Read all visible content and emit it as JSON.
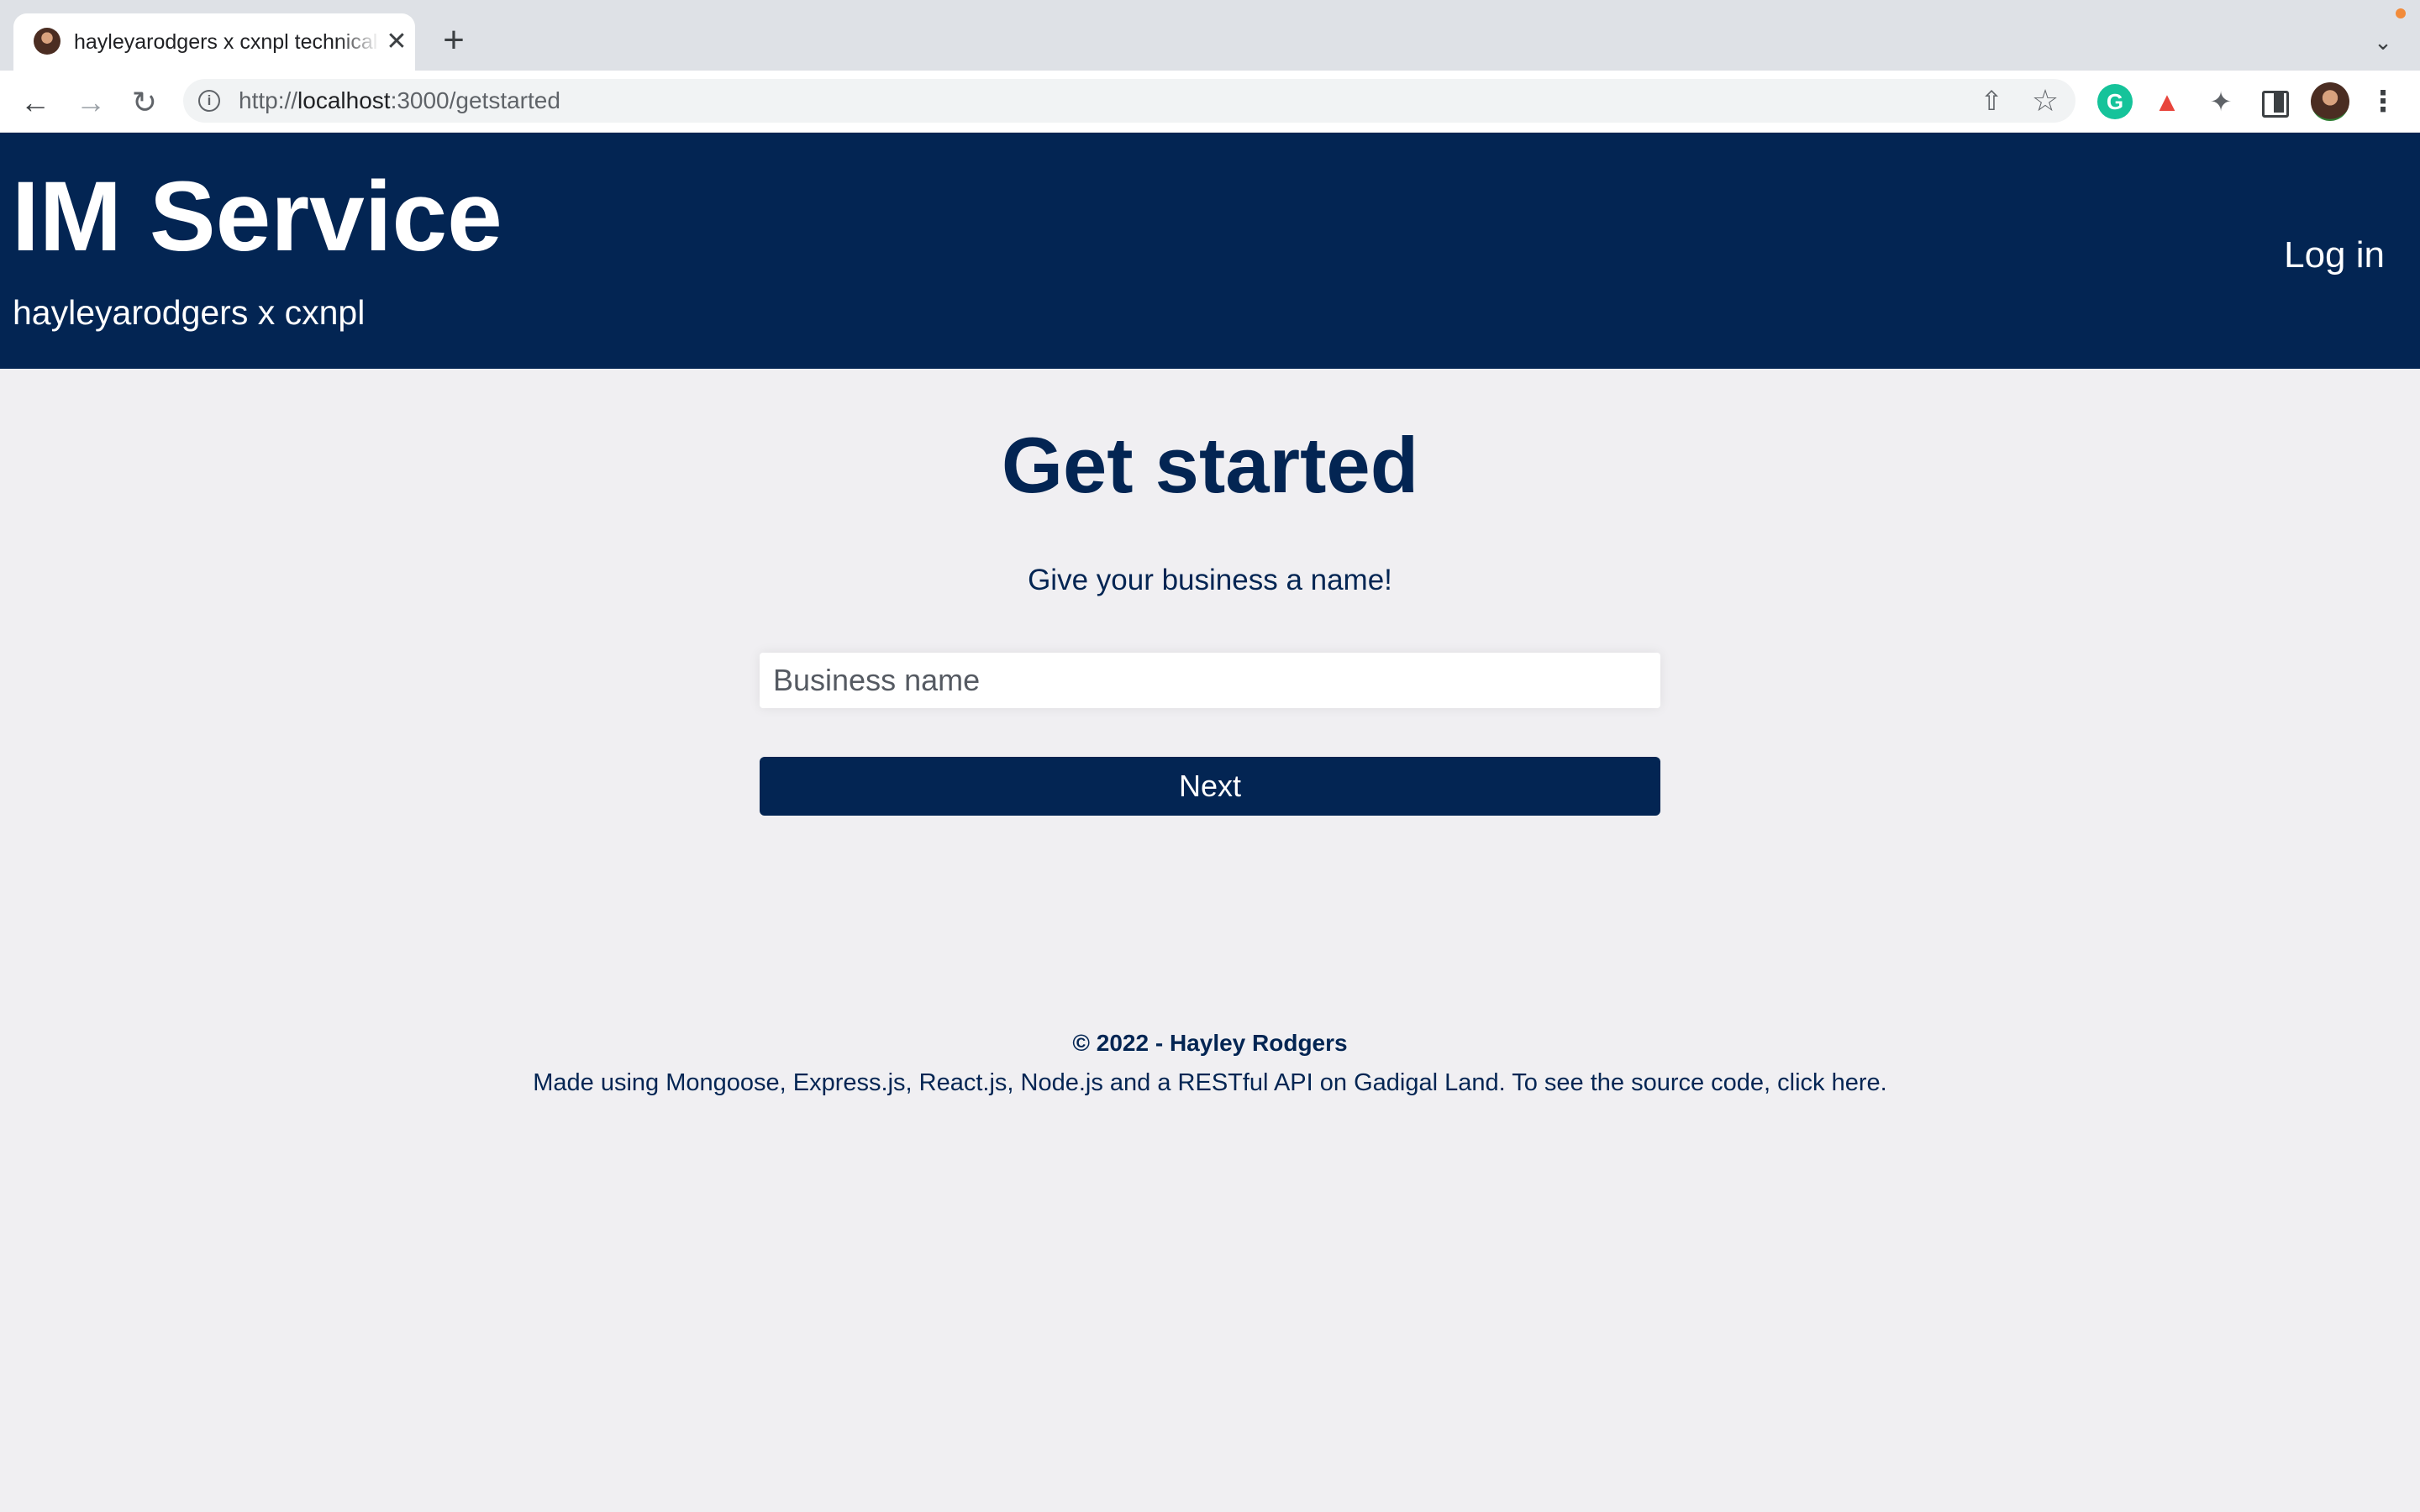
{
  "browser": {
    "tab_title": "hayleyarodgers x cxnpl technical",
    "tab_close": "✕",
    "new_tab": "+",
    "url_scheme": "http://",
    "url_host": "localhost",
    "url_path": ":3000/getstarted",
    "icons": {
      "back": "arrow-left",
      "forward": "arrow-right",
      "reload": "reload",
      "info": "info",
      "share": "share",
      "bookmark": "star",
      "grammarly": "grammarly",
      "extension": "puzzle",
      "side_panel": "side-panel",
      "menu": "kebab-menu",
      "tab_search": "chevron-down"
    },
    "grammarly_letter": "G"
  },
  "header": {
    "title": "IM Service",
    "subtitle": "hayleyarodgers x cxnpl",
    "login_label": "Log in",
    "background_color": "#032553"
  },
  "main": {
    "heading": "Get started",
    "prompt": "Give your business a name!",
    "input": {
      "placeholder": "Business name",
      "value": ""
    },
    "next_label": "Next"
  },
  "footer": {
    "copyright": "© 2022 - Hayley Rodgers",
    "made_using": "Made using Mongoose, Express.js, React.js, Node.js and a RESTful API on Gadigal Land. To see the source code, ",
    "source_link_label": "click here",
    "trailing": "."
  },
  "colors": {
    "primary": "#032553",
    "page_background": "#f0eff2",
    "white": "#ffffff"
  }
}
